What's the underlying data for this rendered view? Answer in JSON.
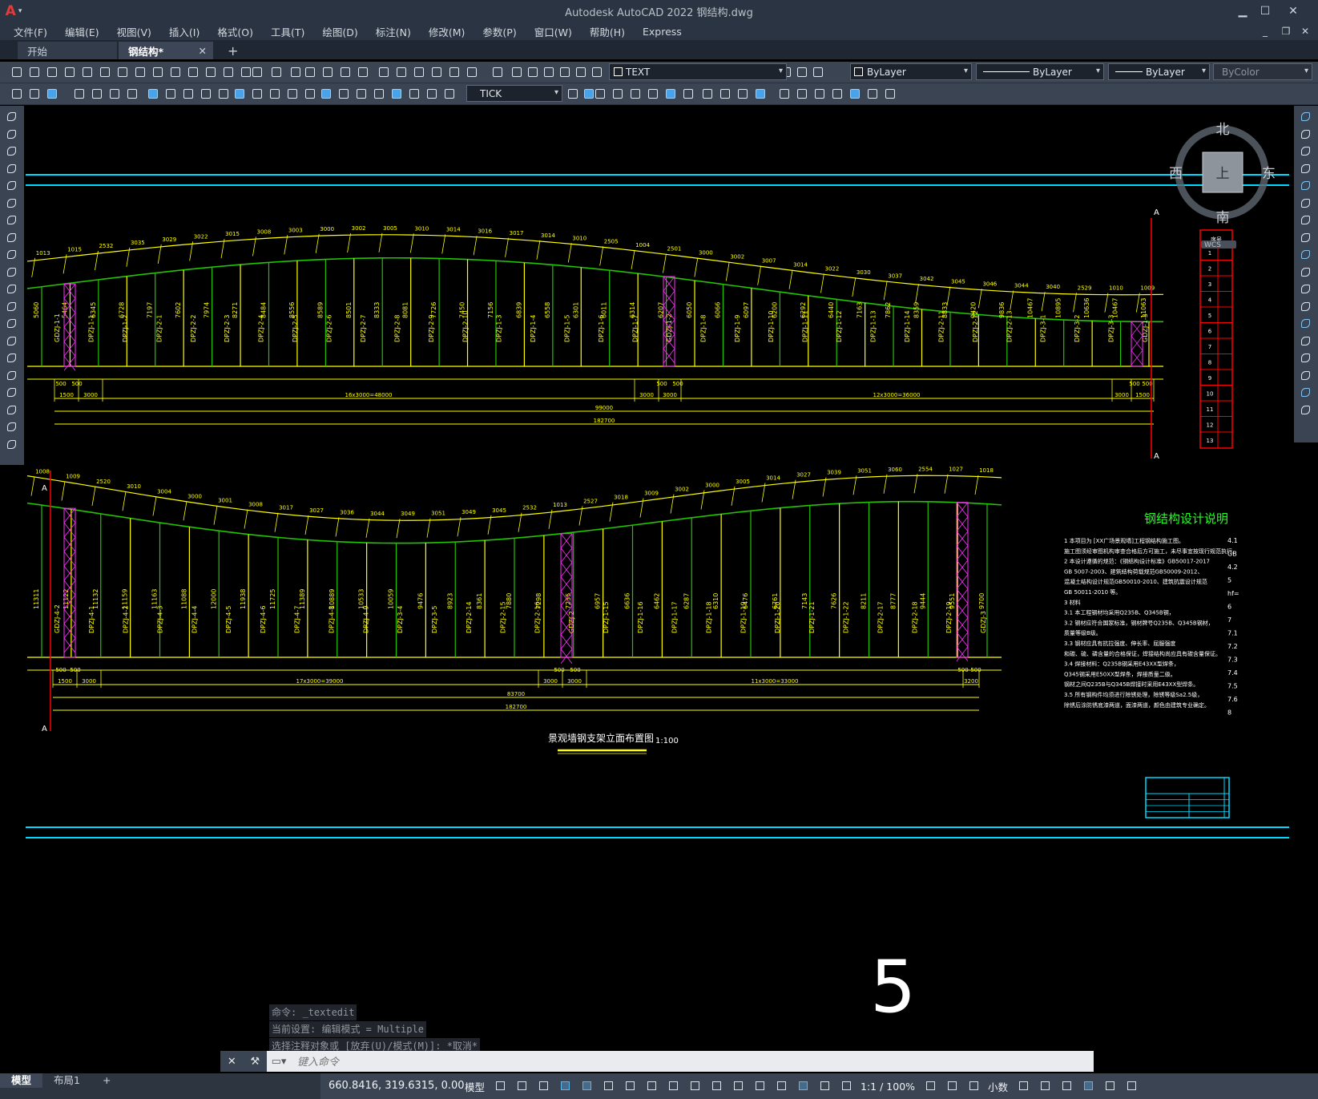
{
  "titlebar": {
    "title": "Autodesk AutoCAD 2022    钢结构.dwg",
    "logo": "A"
  },
  "menu": [
    "文件(F)",
    "编辑(E)",
    "视图(V)",
    "插入(I)",
    "格式(O)",
    "工具(T)",
    "绘图(D)",
    "标注(N)",
    "修改(M)",
    "参数(P)",
    "窗口(W)",
    "帮助(H)",
    "Express"
  ],
  "tabs": {
    "start": "开始",
    "active": "钢结构*",
    "close": "✕",
    "plus": "+"
  },
  "toolbar1": {
    "layer_value": "TEXT",
    "color_value": "ByLayer",
    "linetype_value": "ByLayer",
    "lineweight_value": "ByLayer",
    "plotstyle_value": "ByColor"
  },
  "toolbar2": {
    "dimstyle_value": "TICK"
  },
  "viewcube": {
    "north": "北",
    "south": "南",
    "east": "东",
    "west": "西",
    "top": "上",
    "wcs": "WCS"
  },
  "drawing": {
    "title": "景观墙钢支架立面布置图",
    "scale": "1:100",
    "notes_title": "钢结构设计说明",
    "section_mark": "A",
    "upper": {
      "dim_segments": [
        "1500",
        "3000",
        "16x3000=48000",
        "3000",
        "3000",
        "12x3000=36000",
        "3000",
        "1500"
      ],
      "dim_small": [
        "500",
        "500",
        "500",
        "500",
        "500",
        "500"
      ],
      "dim_total_mid": "99000",
      "dim_total": "182700",
      "top_dims": [
        "1013",
        "1015",
        "2532",
        "3035",
        "3029",
        "3022",
        "3015",
        "3008",
        "3003",
        "3000",
        "3002",
        "3005",
        "3010",
        "3014",
        "3016",
        "3017",
        "3014",
        "3010",
        "2505",
        "1004",
        "2501",
        "3000",
        "3002",
        "3007",
        "3014",
        "3022",
        "3030",
        "3037",
        "3042",
        "3045",
        "3046",
        "3044",
        "3040",
        "2529",
        "1010",
        "1009"
      ],
      "labels": [
        "GDZJ-1-1",
        "DPZJ-1-1",
        "DPZJ-1-2",
        "DPZJ-2-1",
        "DPZJ-2-2",
        "DPZJ-2-3",
        "DPZJ-2-4",
        "DPZJ-2-5",
        "DPZJ-2-6",
        "DPZJ-2-7",
        "DPZJ-2-8",
        "DPZJ-2-9",
        "DPZJ-2-10",
        "DPZJ-1-3",
        "DPZJ-1-4",
        "DPZJ-1-5",
        "DPZJ-1-6",
        "DPZJ-1-7",
        "GDZJ-1-2",
        "DPZJ-1-8",
        "DPZJ-1-9",
        "DPZJ-1-10",
        "DPZJ-1-11",
        "DPZJ-1-12",
        "DPZJ-1-13",
        "DPZJ-1-14",
        "DPZJ-2-11",
        "DPZJ-2-12",
        "DPZJ-2-13",
        "DPZJ-3-1",
        "DPZJ-3-2",
        "DPZJ-3-3",
        "GDZJ-1-3"
      ],
      "heights": [
        "5060",
        "5464",
        "6345",
        "6728",
        "7197",
        "7602",
        "7974",
        "8271",
        "8484",
        "8556",
        "8589",
        "8501",
        "8333",
        "8081",
        "7726",
        "7450",
        "7156",
        "6839",
        "6558",
        "6301",
        "6011",
        "6314",
        "6207",
        "6050",
        "6066",
        "6097",
        "6200",
        "6292",
        "6440",
        "7163",
        "7862",
        "8359",
        "8833",
        "9420",
        "9836",
        "10467",
        "10895",
        "10636",
        "10467",
        "11063"
      ]
    },
    "lower": {
      "dim_segments": [
        "1500",
        "3000",
        "17x3000=39000",
        "3000",
        "3000",
        "11x3000=33000",
        "3200"
      ],
      "dim_small": [
        "500",
        "500",
        "500",
        "500",
        "500",
        "500"
      ],
      "dim_total_mid": "83700",
      "dim_total": "182700",
      "top_dims": [
        "1008",
        "1009",
        "2520",
        "3010",
        "3004",
        "3000",
        "3001",
        "3008",
        "3017",
        "3027",
        "3036",
        "3044",
        "3049",
        "3051",
        "3049",
        "3045",
        "2532",
        "1013",
        "2527",
        "3018",
        "3009",
        "3002",
        "3000",
        "3005",
        "3014",
        "3027",
        "3039",
        "3051",
        "3060",
        "2554",
        "1027",
        "1018"
      ],
      "labels": [
        "GDZJ-4-2",
        "DPZJ-4-1",
        "DPZJ-4-2",
        "DPZJ-4-3",
        "DPZJ-4-4",
        "DPZJ-4-5",
        "DPZJ-4-6",
        "DPZJ-4-7",
        "DPZJ-4-8",
        "DPZJ-4-9",
        "DPZJ-3-4",
        "DPZJ-3-5",
        "DPZJ-2-14",
        "DPZJ-2-15",
        "DPZJ-2-16",
        "GDZJ-2",
        "DPZJ-1-15",
        "DPZJ-1-16",
        "DPZJ-1-17",
        "DPZJ-1-18",
        "DPZJ-1-19",
        "DPZJ-1-20",
        "DPZJ-1-21",
        "DPZJ-1-22",
        "DPZJ-2-17",
        "DPZJ-2-18",
        "DPZJ-2-19",
        "GDZJ-3"
      ],
      "heights": [
        "11311",
        "11122",
        "11132",
        "11159",
        "11163",
        "11088",
        "12000",
        "11938",
        "11725",
        "11389",
        "10889",
        "10533",
        "10059",
        "9476",
        "8923",
        "8361",
        "7880",
        "7298",
        "7235",
        "6957",
        "6636",
        "6462",
        "6287",
        "6310",
        "6476",
        "6761",
        "7143",
        "7626",
        "8211",
        "8777",
        "9444",
        "9551",
        "9700"
      ]
    },
    "notes": [
      "1 本项目为  [XX广场景观墙]工程钢结构施工图。",
      "   施工图须经审图机构审查合格后方可施工，未尽事宜按现行规范执行。",
      "2 本设计遵循的规范：《钢结构设计标准》GB50017-2017",
      "   GB 5007-2003、建筑结构荷载规范GB50009-2012、",
      "   混凝土结构设计规范GB50010-2010、建筑抗震设计规范",
      "   GB 50011-2010 等。",
      "3 材料",
      "3.1 本工程钢材均采用Q235B、Q345B钢，",
      "3.2 钢材应符合国家标准，钢材牌号Q235B、Q345B钢材，",
      "   质量等级B级。",
      "3.3 钢材应具有抗拉强度、伸长率、屈服强度",
      "   和碳、硫、磷含量的合格保证，焊接结构尚应具有碳含量保证。",
      "3.4 焊接材料：Q235B钢采用E43XX型焊条，",
      "Q345钢采用E50XX型焊条，焊接质量二级。",
      "钢材之间Q235B与Q345B焊接时采用E43XX型焊条。",
      "3.5 所有钢构件均须进行除锈处理，除锈等级Sa2.5级，",
      "   除锈后涂防锈底漆两道，面漆两道，颜色由建筑专业确定。"
    ],
    "notes_right": [
      "4.1",
      "GB",
      "4.2",
      "5",
      "hf=",
      "6",
      "7",
      "7.1",
      "7.2",
      "7.3",
      "7.4",
      "7.5",
      "7.6",
      "8"
    ],
    "table_rows": [
      "1",
      "2",
      "3",
      "4",
      "5",
      "6",
      "7",
      "8",
      "9",
      "10",
      "11",
      "12",
      "13"
    ],
    "table_header": "序号",
    "handdrawn": "5"
  },
  "command": {
    "history": [
      "命令:  _textedit",
      "当前设置: 编辑模式 = Multiple",
      "选择注释对象或 [放弃(U)/模式(M)]: *取消*"
    ],
    "placeholder": "键入命令"
  },
  "status": {
    "tabs": [
      "模型",
      "布局1"
    ],
    "add_tab": "+",
    "coordinates": "660.8416, 319.6315, 0.0000",
    "model": "模型",
    "scale": "1:1 / 100%",
    "units": "小数"
  },
  "colors": {
    "yellow": "#ffff00",
    "green": "#22c400",
    "cyan": "#00d8ff",
    "magenta": "#ff30ff",
    "red": "#ff0000"
  },
  "icons": [
    "new-icon",
    "open-icon",
    "save-icon",
    "print-icon",
    "undo-icon",
    "redo-icon",
    "pan-icon",
    "zoom-icon",
    "help-icon",
    "line-icon",
    "circle-icon",
    "arc-icon",
    "move-icon",
    "copy-icon",
    "rotate-icon",
    "grid-icon",
    "snap-icon",
    "ortho-icon",
    "polar-icon",
    "osnap-icon",
    "gear-icon",
    "plus-icon"
  ]
}
